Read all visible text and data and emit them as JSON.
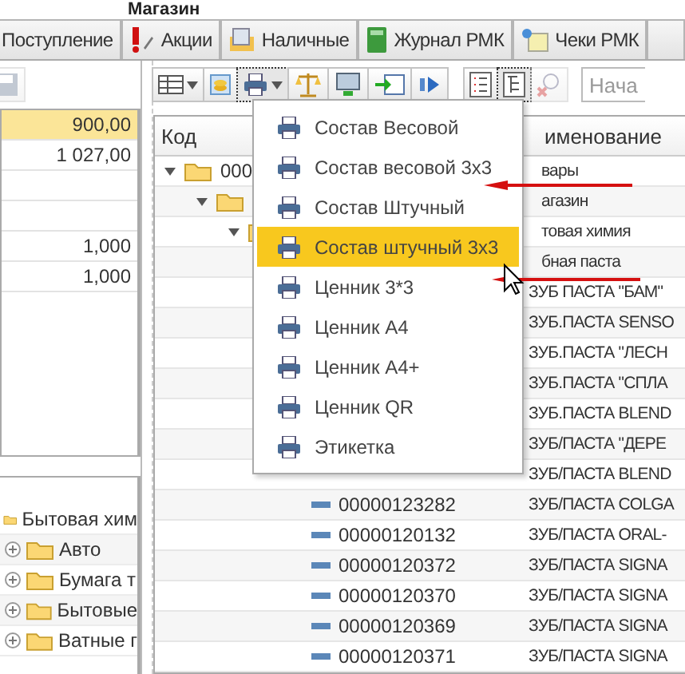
{
  "window": {
    "title": "Магазин"
  },
  "tabs": [
    {
      "label": "Поступление"
    },
    {
      "label": "Акции"
    },
    {
      "label": "Наличные"
    },
    {
      "label": "Журнал РМК"
    },
    {
      "label": "Чеки РМК"
    }
  ],
  "left_panel": {
    "toolbar": [
      {
        "disabled": true
      }
    ],
    "rows": [
      {
        "value": "900,00",
        "selected": true
      },
      {
        "value": "1 027,00",
        "selected": false
      },
      {
        "selected": false
      },
      {
        "selected": false
      },
      {
        "value": "1,000",
        "selected": false
      },
      {
        "value": "1,000",
        "selected": false
      }
    ],
    "tree": {
      "name": "Бытовая хим",
      "children": [
        {
          "name": "Авто",
          "expanded": false
        },
        {
          "name": "Бумага т",
          "expanded": false
        },
        {
          "name": "Бытовые",
          "expanded": false
        },
        {
          "name": "Ватные г",
          "expanded": false
        }
      ]
    }
  },
  "toolbar": [
    {
      "pressed": false,
      "dropdown": true
    },
    {
      "pressed": false,
      "dropdown": false
    },
    {
      "pressed": true,
      "dropdown": true
    },
    {
      "pressed": false,
      "dropdown": false
    },
    {
      "pressed": false,
      "dropdown": false
    },
    {
      "pressed": false,
      "dropdown": false
    },
    {
      "pressed": false,
      "dropdown": false
    }
  ],
  "view_toolbar": [
    {
      "pressed": false,
      "disabled": false
    },
    {
      "pressed": true,
      "disabled": false
    },
    {
      "pressed": false,
      "disabled": true
    }
  ],
  "search": {
    "placeholder": "Нача"
  },
  "table": {
    "columns": [
      "Код",
      "именование"
    ],
    "rows": [
      {
        "kind": "folder",
        "expanded": true,
        "code": "000",
        "name": "вары",
        "children": [
          {
            "kind": "folder",
            "expanded": true,
            "name": "агазин",
            "children": [
              {
                "kind": "folder",
                "expanded": true,
                "name": "товая химия",
                "children": [
                  {
                    "kind": "folder",
                    "name": "бная паста",
                    "children": [
                      {
                        "kind": "item",
                        "name": "ЗУБ ПАСТА \"БАМ\""
                      },
                      {
                        "kind": "item",
                        "name": "ЗУБ.ПАСТА SENSO"
                      },
                      {
                        "kind": "item",
                        "name": "ЗУБ.ПАСТА \"ЛЕСН"
                      },
                      {
                        "kind": "item",
                        "name": "ЗУБ.ПАСТА \"СПЛА"
                      },
                      {
                        "kind": "item",
                        "name": "ЗУБ.ПАСТА BLEND"
                      },
                      {
                        "kind": "item",
                        "name": "ЗУБ/ПАСТА \"ДЕРЕ"
                      },
                      {
                        "kind": "item",
                        "name": "ЗУБ/ПАСТА BLEND"
                      },
                      {
                        "kind": "item",
                        "code": "00000123282",
                        "name": "ЗУБ/ПАСТА COLGA"
                      },
                      {
                        "kind": "item",
                        "code": "00000120132",
                        "name": "ЗУБ/ПАСТА ORAL-"
                      },
                      {
                        "kind": "item",
                        "code": "00000120372",
                        "name": "ЗУБ/ПАСТА SIGNA"
                      },
                      {
                        "kind": "item",
                        "code": "00000120370",
                        "name": "ЗУБ/ПАСТА SIGNA"
                      },
                      {
                        "kind": "item",
                        "code": "00000120369",
                        "name": "ЗУБ/ПАСТА SIGNA"
                      },
                      {
                        "kind": "item",
                        "code": "00000120371",
                        "name": "ЗУБ/ПАСТА SIGNA"
                      }
                    ]
                  }
                ]
              }
            ]
          }
        ]
      }
    ]
  },
  "print_menu": {
    "items": [
      {
        "label": "Состав Весовой",
        "selected": false
      },
      {
        "label": "Состав весовой 3x3",
        "selected": false
      },
      {
        "label": "Состав Штучный",
        "selected": false
      },
      {
        "label": "Состав штучный 3x3",
        "selected": true
      },
      {
        "label": "Ценник 3*3",
        "selected": false
      },
      {
        "label": "Ценник А4",
        "selected": false
      },
      {
        "label": "Ценник А4+",
        "selected": false
      },
      {
        "label": "Ценник QR",
        "selected": false
      },
      {
        "label": "Этикетка",
        "selected": false
      }
    ]
  }
}
